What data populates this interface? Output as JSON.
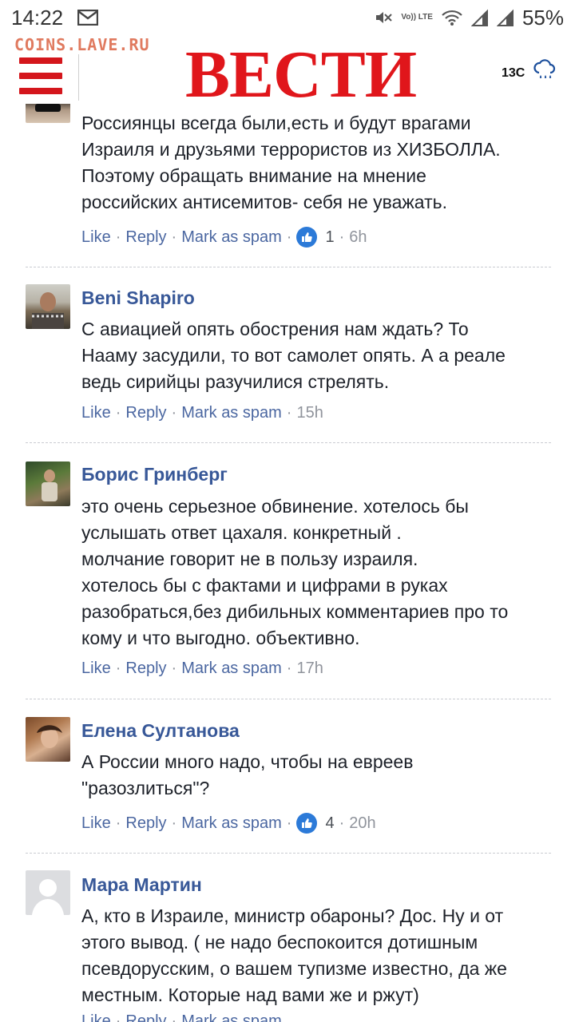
{
  "status_bar": {
    "time": "14:22",
    "battery": "55%",
    "volte_label": "Vo)) LTE"
  },
  "header": {
    "watermark": "COINS.LAVE.RU",
    "logo": "ВЕСТИ",
    "weather_temp": "13C",
    "weather_icon": "rain-cloud-icon"
  },
  "actions": {
    "like": "Like",
    "reply": "Reply",
    "spam": "Mark as spam"
  },
  "comments": [
    {
      "author": "",
      "lines": [
        "Россиянцы всегда были,есть и будут врагами",
        "Израиля и друзьями террористов из ХИЗБОЛЛА.",
        "Поэтому обращать внимание на мнение",
        "российских антисемитов- себя не уважать."
      ],
      "likes": "1",
      "time": "6h"
    },
    {
      "author": "Beni Shapiro",
      "lines": [
        "С авиацией опять обострения нам ждать? То",
        "Нааму засудили, то вот самолет опять. А а реале",
        "ведь сирийцы разучилися стрелять."
      ],
      "likes": "",
      "time": "15h"
    },
    {
      "author": "Борис Гринберг",
      "lines": [
        "это очень серьезное обвинение. хотелось бы",
        "услышать ответ цахаля. конкретный .",
        "молчание говорит не в пользу израиля.",
        "хотелось бы с фактами и цифрами в руках",
        "разобраться,без дибильных комментариев про то",
        "кому и что выгодно. объективно."
      ],
      "likes": "",
      "time": "17h"
    },
    {
      "author": "Елена Султанова",
      "lines": [
        "А России много надо, чтобы на евреев",
        "\"разозлиться\"?"
      ],
      "likes": "4",
      "time": "20h"
    },
    {
      "author": "Мара Мартин",
      "lines": [
        "А, кто в Израиле, министр обароны? Дос. Ну и от",
        "этого вывод. ( не надо беспокоится дотишным",
        "псевдорусским, о вашем тупизме известно, да же",
        "местным. Которые над вами же и ржут)"
      ],
      "likes": "",
      "time": ""
    }
  ]
}
